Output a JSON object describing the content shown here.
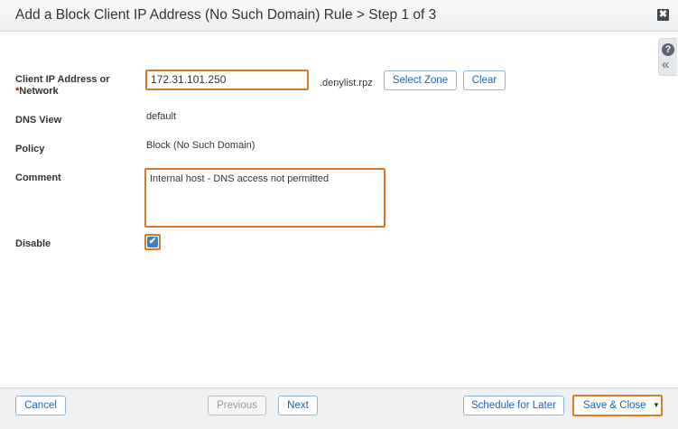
{
  "dialog": {
    "title": "Add a Block Client IP Address (No Such Domain) Rule > Step 1 of 3",
    "close_glyph": "✖"
  },
  "side_panel": {
    "help_glyph": "?",
    "collapse_glyph": "«"
  },
  "form": {
    "client_ip": {
      "label_line1": "Client IP Address or",
      "label_req": "*",
      "label_line2": "Network",
      "value": "172.31.101.250",
      "zone_suffix": ".denylist.rpz",
      "select_zone_label": "Select Zone",
      "clear_label": "Clear"
    },
    "dns_view": {
      "label": "DNS View",
      "value": "default"
    },
    "policy": {
      "label": "Policy",
      "value": "Block (No Such Domain)"
    },
    "comment": {
      "label": "Comment",
      "value": "Internal host - DNS access not permitted"
    },
    "disable": {
      "label": "Disable",
      "checked": true,
      "check_glyph": "✔"
    }
  },
  "footer": {
    "cancel_label": "Cancel",
    "previous_label": "Previous",
    "next_label": "Next",
    "schedule_label": "Schedule for Later",
    "save_close_label": "Save & Close",
    "save_caret_glyph": "▼"
  },
  "colors": {
    "accent_focus": "#d97b26",
    "link_blue": "#1b63b0",
    "checkbox_blue": "#3b7fc4"
  }
}
